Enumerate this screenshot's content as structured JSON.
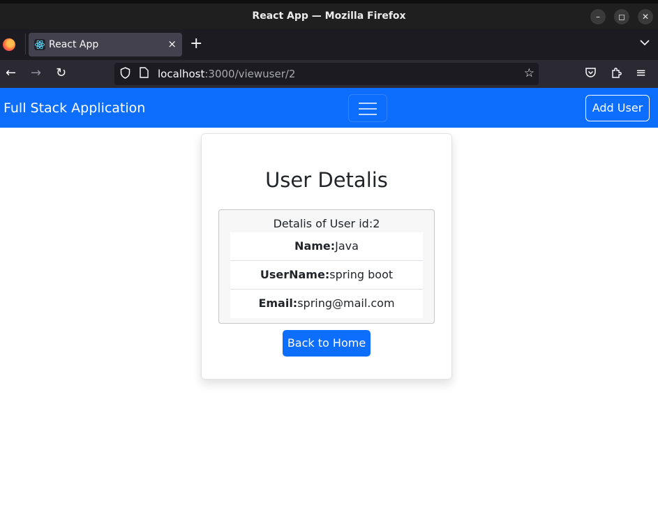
{
  "window": {
    "title": "React App — Mozilla Firefox",
    "controls": {
      "minimize": "–",
      "restore": "◻",
      "close": "✕"
    }
  },
  "browser": {
    "tab": {
      "label": "React App",
      "close": "×"
    },
    "new_tab": "+",
    "tab_list": "⌄",
    "nav": {
      "back": "←",
      "forward": "→",
      "reload": "↻"
    },
    "url": {
      "host": "localhost",
      "rest": ":3000/viewuser/2"
    },
    "icons": {
      "shield": "⛉",
      "page": "🗋",
      "star": "☆",
      "pocket": "⛉",
      "extensions": "✚",
      "menu": "≡"
    }
  },
  "app": {
    "brand": "Full Stack Application",
    "add_user_label": "Add User",
    "accent_color": "#0d6efd"
  },
  "card": {
    "title": "User Detalis",
    "header": "Detalis of User id:2",
    "fields": [
      {
        "label": "Name:",
        "value": "Java"
      },
      {
        "label": "UserName:",
        "value": "spring boot"
      },
      {
        "label": "Email:",
        "value": "spring@mail.com"
      }
    ],
    "back_button": "Back to Home"
  }
}
